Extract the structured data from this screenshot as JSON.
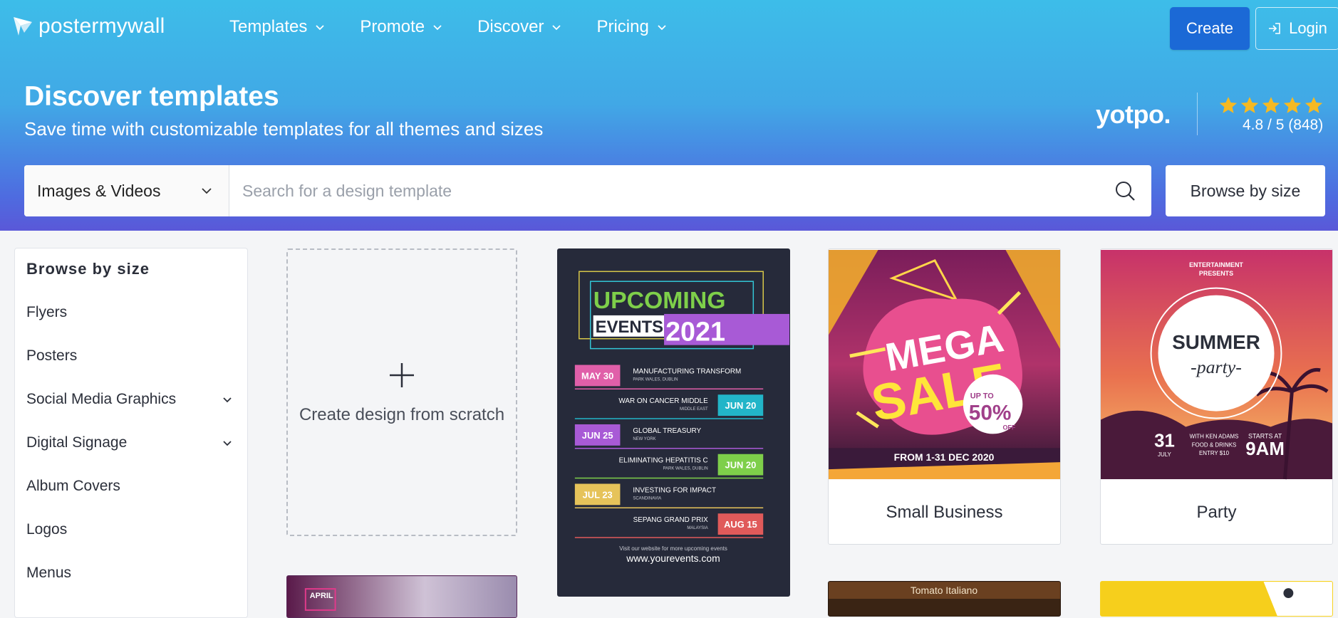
{
  "header": {
    "logo_text": "postermywall",
    "nav": [
      {
        "label": "Templates"
      },
      {
        "label": "Promote"
      },
      {
        "label": "Discover"
      },
      {
        "label": "Pricing"
      }
    ],
    "create_label": "Create",
    "login_label": "Login"
  },
  "hero": {
    "title": "Discover templates",
    "subtitle": "Save time with customizable templates for all themes and sizes",
    "yotpo": "yotpo.",
    "rating_text": "4.8 / 5 (848)",
    "star_count": 5,
    "star_color": "#f5b923"
  },
  "search": {
    "type_label": "Images & Videos",
    "placeholder": "Search for a design template",
    "value": "",
    "browse_label": "Browse by size"
  },
  "sidebar": {
    "title": "Browse by size",
    "items": [
      {
        "label": "Flyers",
        "expandable": false
      },
      {
        "label": "Posters",
        "expandable": false
      },
      {
        "label": "Social Media Graphics",
        "expandable": true
      },
      {
        "label": "Digital Signage",
        "expandable": true
      },
      {
        "label": "Album Covers",
        "expandable": false
      },
      {
        "label": "Logos",
        "expandable": false
      },
      {
        "label": "Menus",
        "expandable": false
      }
    ]
  },
  "cards": {
    "scratch_label": "Create design from scratch",
    "events": {
      "title_line1": "UPCOMING",
      "title_line2": "EVENTS",
      "year": "2021",
      "rows": [
        {
          "date": "MAY 30",
          "title": "MANUFACTURING TRANSFORM",
          "place": "PARK WALES, DUBLIN",
          "side": "left",
          "color": "#e05fa9"
        },
        {
          "date": "JUN 20",
          "title": "WAR ON CANCER MIDDLE",
          "place": "MIDDLE EAST",
          "side": "right",
          "color": "#22b5c8"
        },
        {
          "date": "JUN 25",
          "title": "GLOBAL TREASURY",
          "place": "NEW YORK",
          "side": "left",
          "color": "#a85ad6"
        },
        {
          "date": "JUN 20",
          "title": "ELIMINATING HEPATITIS C",
          "place": "PARK WALES, DUBLIN",
          "side": "right",
          "color": "#7ecf4a"
        },
        {
          "date": "JUL 23",
          "title": "INVESTING FOR IMPACT",
          "place": "SCANDINAVIA",
          "side": "left",
          "color": "#e6c35a"
        },
        {
          "date": "AUG 15",
          "title": "SEPANG GRAND PRIX",
          "place": "MALAYSIA",
          "side": "right",
          "color": "#e05a5a"
        }
      ],
      "footer_small": "Visit our website for more upcoming events",
      "footer_url": "www.yourevents.com"
    },
    "sale": {
      "mega": "MEGA",
      "sale": "SALE",
      "upto": "UP TO",
      "percent": "50%",
      "off": "OFF",
      "dates": "FROM 1-31 DEC 2020",
      "caption": "Small Business"
    },
    "party": {
      "presents1": "ENTERTAINMENT",
      "presents2": "PRESENTS",
      "summer": "SUMMER",
      "party": "-party-",
      "day": "31",
      "month": "JULY",
      "info1": "WITH KEN ADAMS",
      "info2": "FOOD & DRINKS",
      "info3": "ENTRY $10",
      "starts": "STARTS AT",
      "time": "9AM",
      "caption": "Party"
    },
    "bottom": {
      "april": "APRIL",
      "tomato": "Tomato Italiano"
    }
  }
}
